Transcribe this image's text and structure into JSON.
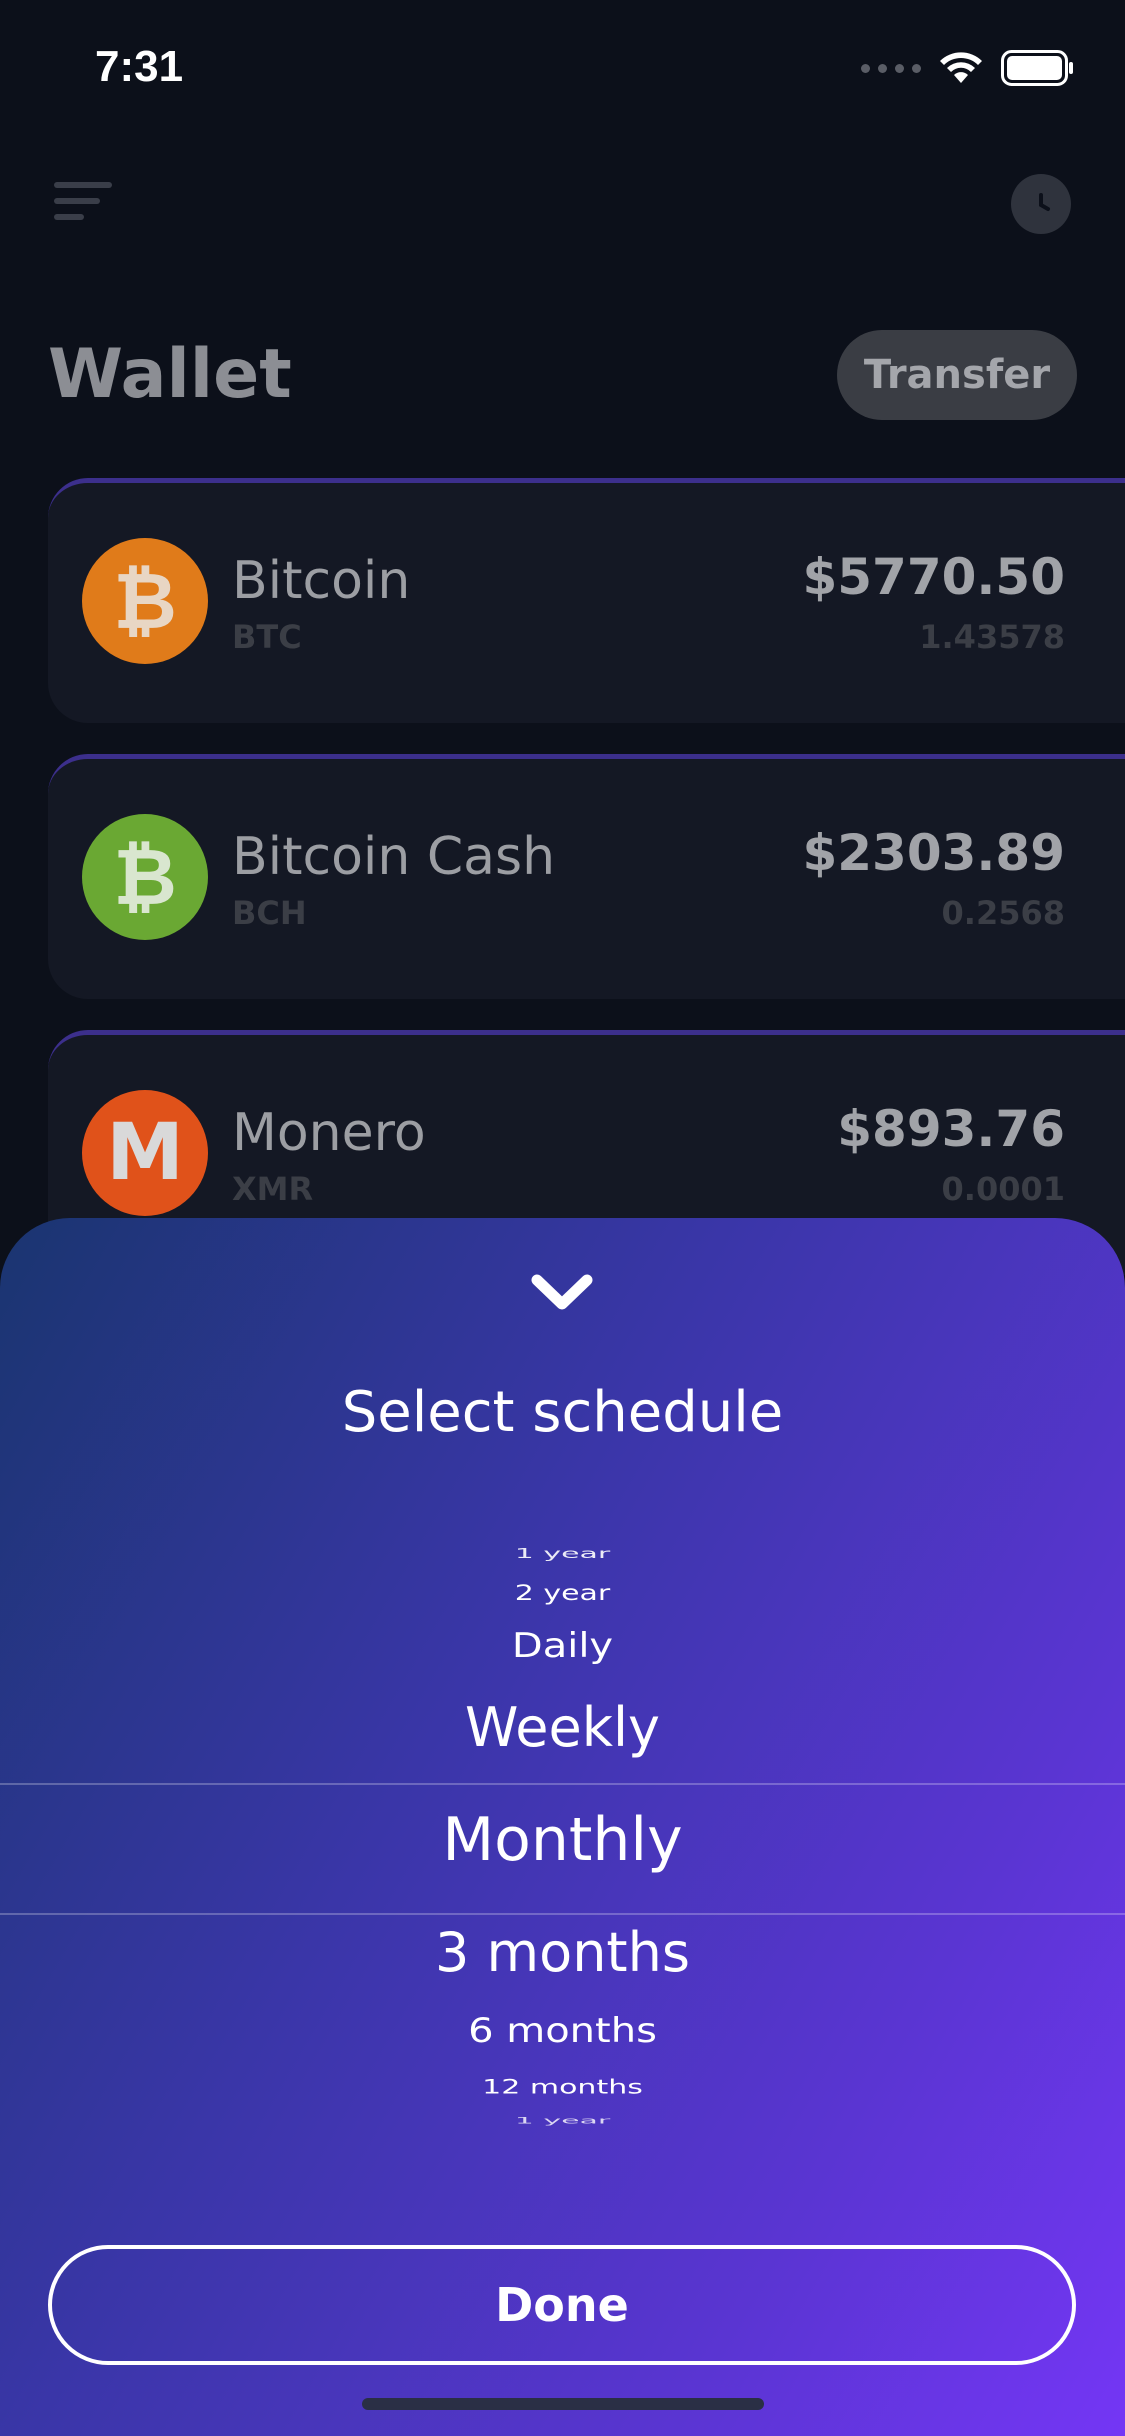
{
  "status_bar": {
    "time": "7:31"
  },
  "header": {
    "title": "Wallet",
    "transfer_label": "Transfer"
  },
  "coins": [
    {
      "name": "Bitcoin",
      "ticker": "BTC",
      "value": "$5770.50",
      "amount": "1.43578",
      "logo_glyph": "₿",
      "color": "#e07b1a"
    },
    {
      "name": "Bitcoin Cash",
      "ticker": "BCH",
      "value": "$2303.89",
      "amount": "0.2568",
      "logo_glyph": "₿",
      "color": "#6aa833"
    },
    {
      "name": "Monero",
      "ticker": "XMR",
      "value": "$893.76",
      "amount": "0.0001",
      "logo_glyph": "M",
      "color": "#e0521a"
    }
  ],
  "sheet": {
    "title": "Select schedule",
    "picker_options": [
      "1 year",
      "2 year",
      "Daily",
      "Weekly",
      "Monthly",
      "3 months",
      "6 months",
      "12 months",
      "1 year"
    ],
    "selected": "Monthly",
    "done_label": "Done"
  }
}
